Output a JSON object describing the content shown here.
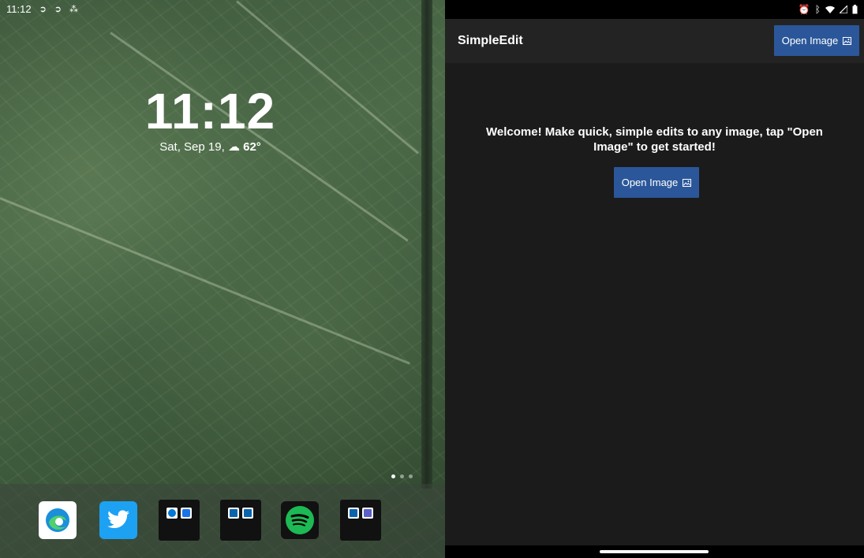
{
  "left_status": {
    "time": "11:12"
  },
  "lockscreen": {
    "clock": "11:12",
    "date": "Sat, Sep 19,",
    "weather_icon": "cloud-icon",
    "temperature": "62°"
  },
  "dock": {
    "apps": [
      {
        "name": "Microsoft Edge",
        "icon": "edge-icon"
      },
      {
        "name": "Twitter",
        "icon": "twitter-icon"
      },
      {
        "name": "Skype + Messages",
        "icon": "app-pair-icon"
      },
      {
        "name": "Outlook + Outlook",
        "icon": "app-pair-icon"
      },
      {
        "name": "Spotify",
        "icon": "spotify-icon"
      },
      {
        "name": "Outlook + Teams",
        "icon": "app-pair-icon"
      }
    ],
    "page_count": 3,
    "active_page": 1
  },
  "right_status": {
    "icons": [
      "alarm-icon",
      "bluetooth-icon",
      "wifi-icon",
      "signal-icon",
      "battery-icon"
    ]
  },
  "app": {
    "title": "SimpleEdit",
    "open_button_label": "Open Image",
    "welcome_text": "Welcome! Make quick, simple edits to any image, tap \"Open Image\" to get started!",
    "main_button_label": "Open Image"
  },
  "colors": {
    "accent": "#2b579a",
    "app_background": "#1b1b1b",
    "appbar_background": "#232323"
  }
}
